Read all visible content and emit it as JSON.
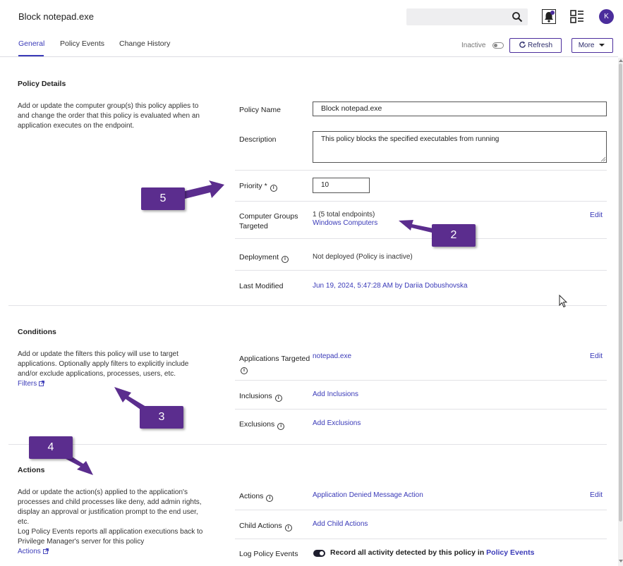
{
  "header": {
    "title": "Block notepad.exe",
    "search": {
      "placeholder": "",
      "icon": "search-icon"
    },
    "avatar_initial": "K"
  },
  "tabs": [
    {
      "label": "General",
      "active": true
    },
    {
      "label": "Policy Events",
      "active": false
    },
    {
      "label": "Change History",
      "active": false
    }
  ],
  "toolbar": {
    "inactive_label": "Inactive",
    "refresh_label": "Refresh",
    "more_label": "More"
  },
  "policy_details": {
    "title": "Policy Details",
    "description": "Add or update the computer group(s) this policy applies to and change the order that this policy is evaluated when an application executes on the endpoint.",
    "policy_name_label": "Policy Name",
    "policy_name_value": "Block notepad.exe",
    "description_label": "Description",
    "description_value": "This policy blocks the specified executables from running",
    "priority_label": "Priority *",
    "priority_value": "10",
    "computer_groups_label_1": "Computer Groups",
    "computer_groups_label_2": "Targeted",
    "computer_groups_count": "1 (5 total endpoints)",
    "computer_groups_link": "Windows Computers",
    "edit_label": "Edit",
    "deployment_label": "Deployment",
    "deployment_value": "Not deployed (Policy is inactive)",
    "last_modified_label": "Last Modified",
    "last_modified_value": "Jun 19, 2024, 5:47:28 AM by Dariia Dobushovska"
  },
  "conditions": {
    "title": "Conditions",
    "description": "Add or update the filters this policy will use to target applications. Optionally apply filters to explicitly include and/or exclude applications, processes, users, etc.",
    "filters_link": "Filters",
    "applications_label": "Applications Targeted",
    "applications_value": "notepad.exe",
    "edit_label": "Edit",
    "inclusions_label": "Inclusions",
    "inclusions_link": "Add Inclusions",
    "exclusions_label": "Exclusions",
    "exclusions_link": "Add Exclusions"
  },
  "actions": {
    "title": "Actions",
    "description": "Add or update the action(s) applied to the application's processes and child processes like deny, add admin rights, display an approval or justification prompt to the end user, etc.",
    "description_2": "Log Policy Events reports all application executions back to Privilege Manager's server for this policy",
    "actions_link": "Actions",
    "actions_label": "Actions",
    "actions_value": "Application Denied Message Action",
    "edit_label": "Edit",
    "child_actions_label": "Child Actions",
    "child_actions_link": "Add Child Actions",
    "log_label": "Log Policy Events",
    "log_text": "Record all activity detected by this policy in ",
    "log_link": "Policy Events",
    "log_enabled": true
  },
  "callouts": [
    "5",
    "2",
    "3",
    "4"
  ],
  "colors": {
    "accent": "#3a3ab8",
    "brand": "#4b2d9c",
    "callout": "#5b2d8e"
  }
}
